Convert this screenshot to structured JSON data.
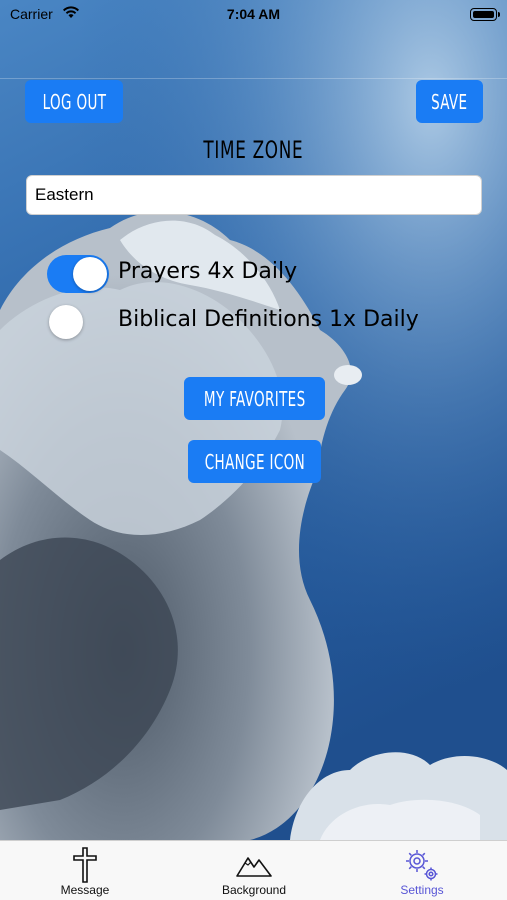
{
  "status_bar": {
    "carrier": "Carrier",
    "time": "7:04 AM"
  },
  "header": {
    "logout_label": "LOG OUT",
    "save_label": "SAVE"
  },
  "time_zone": {
    "title": "TIME ZONE",
    "value": "Eastern"
  },
  "toggles": [
    {
      "label": "Prayers 4x Daily",
      "on": true
    },
    {
      "label": "Biblical Definitions 1x Daily",
      "on": false
    }
  ],
  "actions": {
    "favorites_label": "MY FAVORITES",
    "change_icon_label": "CHANGE ICON"
  },
  "tab_bar": {
    "items": [
      {
        "label": "Message",
        "icon": "cross-icon"
      },
      {
        "label": "Background",
        "icon": "mountains-icon"
      },
      {
        "label": "Settings",
        "icon": "gears-icon",
        "selected": true
      }
    ]
  },
  "colors": {
    "accent": "#1a7cf4",
    "selected_tab": "#5856d6"
  }
}
